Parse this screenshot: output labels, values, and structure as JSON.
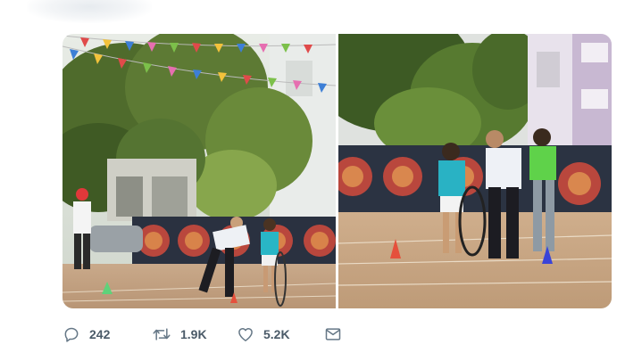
{
  "tweet": {
    "media": [
      {
        "scene": "school-sports-day-hoop-race-wide"
      },
      {
        "scene": "school-sports-day-hoop-race-closeup"
      }
    ],
    "actions": {
      "reply": {
        "icon": "reply-icon",
        "count": "242"
      },
      "retweet": {
        "icon": "retweet-icon",
        "count": "1.9K"
      },
      "like": {
        "icon": "heart-icon",
        "count": "5.2K"
      },
      "message": {
        "icon": "envelope-icon"
      }
    }
  },
  "colors": {
    "icon_gray": "#657786",
    "count_gray": "#4a5a68"
  }
}
